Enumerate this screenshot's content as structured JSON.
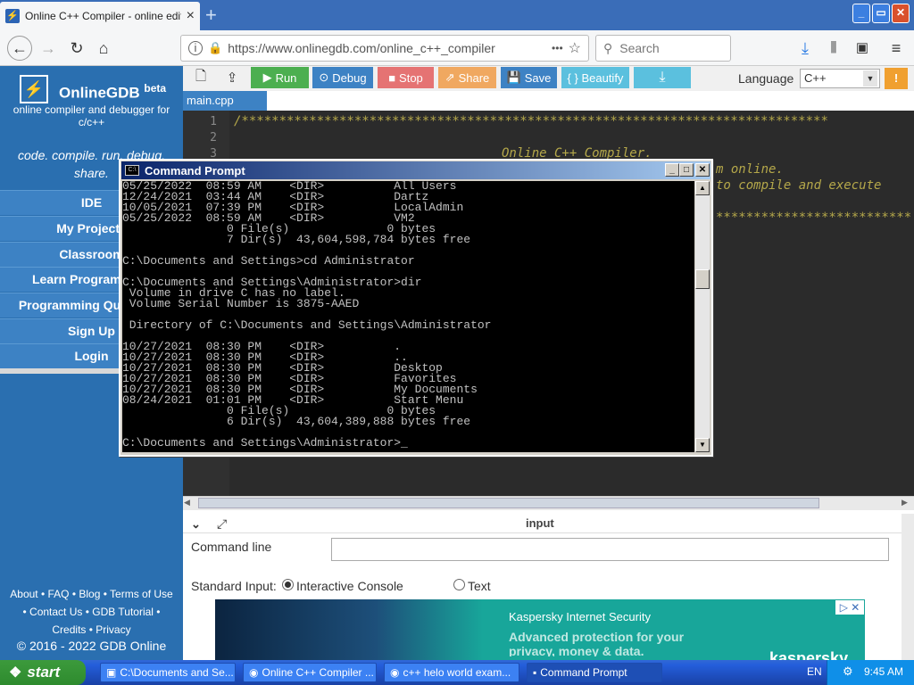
{
  "browser": {
    "tab_title": "Online C++ Compiler - online edito",
    "tab_close": "×",
    "new_tab": "+",
    "url": "https://www.onlinegdb.com/online_c++_compiler",
    "url_more": "•••",
    "search_placeholder": "Search",
    "win_min": "_",
    "win_max": "▭",
    "win_close": "✕"
  },
  "sidebar": {
    "brand": "OnlineGDB",
    "brand_sup": "beta",
    "brand_sub": "online compiler and debugger for c/c++",
    "motto": "code. compile. run. debug. share.",
    "items": [
      {
        "label": "IDE"
      },
      {
        "label": "My Projects"
      },
      {
        "label": "Classroom"
      },
      {
        "label": "Learn Programming"
      },
      {
        "label": "Programming Questions"
      },
      {
        "label": "Sign Up"
      },
      {
        "label": "Login"
      }
    ],
    "footer_line1": "About • FAQ • Blog • Terms of Use",
    "footer_line2": "• Contact Us • GDB Tutorial •",
    "footer_line3": "Credits • Privacy",
    "copyright": "© 2016 - 2022 GDB Online"
  },
  "toolbar": {
    "run": "Run",
    "debug": "Debug",
    "stop": "Stop",
    "share": "Share",
    "save": "Save",
    "beautify": "{ } Beautify",
    "language_label": "Language",
    "language_value": "C++",
    "colors": {
      "run": "#4caf50",
      "debug": "#3d82c4",
      "stop": "#e57373",
      "share": "#f0a860",
      "save": "#3d82c4",
      "beautify": "#5bc0de"
    }
  },
  "editor": {
    "file_tab": "main.cpp",
    "line_numbers": [
      "1",
      "2",
      "3"
    ],
    "line1": "/******************************************************************************",
    "line3": "Online C++ Compiler.",
    "line4": "m online.",
    "line5": "to compile and execute",
    "line6": "******************************************************************************"
  },
  "panel": {
    "input_title": "input",
    "command_line_label": "Command line",
    "standard_input_label": "Standard Input:",
    "option_interactive": "Interactive Console",
    "option_text": "Text"
  },
  "ad": {
    "title": "Kaspersky Internet Security",
    "text": "Advanced protection for your privacy, money & data.",
    "logo": "kaspersky"
  },
  "cmd": {
    "title": "Command Prompt",
    "lines": [
      "05/25/2022  08:59 AM    <DIR>          All Users",
      "12/24/2021  03:44 AM    <DIR>          Dartz",
      "10/05/2021  07:39 PM    <DIR>          LocalAdmin",
      "05/25/2022  08:59 AM    <DIR>          VM2",
      "               0 File(s)              0 bytes",
      "               7 Dir(s)  43,604,598,784 bytes free",
      "",
      "C:\\Documents and Settings>cd Administrator",
      "",
      "C:\\Documents and Settings\\Administrator>dir",
      " Volume in drive C has no label.",
      " Volume Serial Number is 3875-AAED",
      "",
      " Directory of C:\\Documents and Settings\\Administrator",
      "",
      "10/27/2021  08:30 PM    <DIR>          .",
      "10/27/2021  08:30 PM    <DIR>          ..",
      "10/27/2021  08:30 PM    <DIR>          Desktop",
      "10/27/2021  08:30 PM    <DIR>          Favorites",
      "10/27/2021  08:30 PM    <DIR>          My Documents",
      "08/24/2021  01:01 PM    <DIR>          Start Menu",
      "               0 File(s)              0 bytes",
      "               6 Dir(s)  43,604,389,888 bytes free",
      "",
      "C:\\Documents and Settings\\Administrator>_"
    ]
  },
  "taskbar": {
    "start": "start",
    "tasks": [
      {
        "label": "C:\\Documents and Se..."
      },
      {
        "label": "Online C++ Compiler ..."
      },
      {
        "label": "c++ helo world exam..."
      },
      {
        "label": "Command Prompt"
      }
    ],
    "language": "EN",
    "clock": "9:45 AM"
  }
}
